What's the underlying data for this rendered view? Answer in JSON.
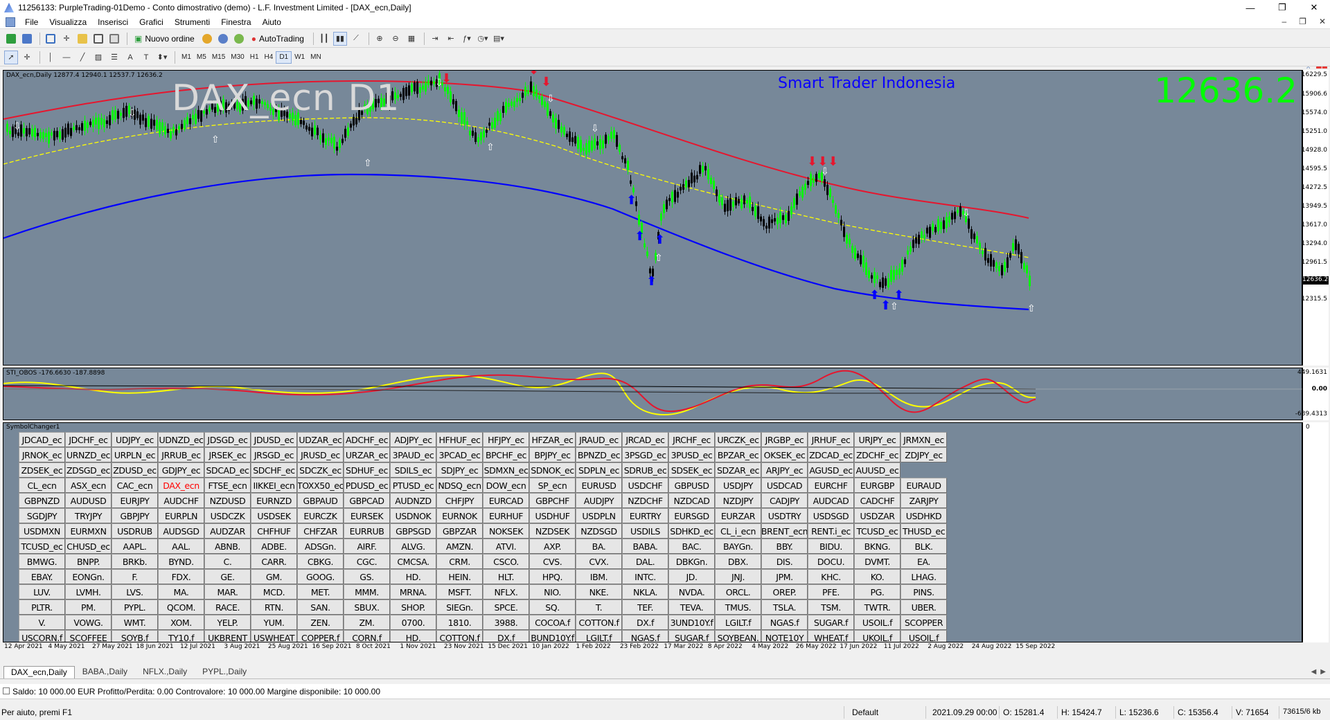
{
  "window": {
    "title": "11256133: PurpleTrading-01Demo - Conto dimostrativo (demo) - L.F. Investment Limited - [DAX_ecn,Daily]",
    "minimize": "—",
    "restore": "❐",
    "close": "✕"
  },
  "menu": [
    "File",
    "Visualizza",
    "Inserisci",
    "Grafici",
    "Strumenti",
    "Finestra",
    "Aiuto"
  ],
  "toolbar": {
    "new_order_label": "Nuovo ordine",
    "autotrading_label": "AutoTrading",
    "notification_count": "1"
  },
  "timeframes": [
    "M1",
    "M5",
    "M15",
    "M30",
    "H1",
    "H4",
    "D1",
    "W1",
    "MN"
  ],
  "active_timeframe": "D1",
  "chart": {
    "info": "DAX_ecn,Daily  12877.4 12940.1 12537.7 12636.2",
    "symbol_watermark": "DAX_ecn D1",
    "brand": "Smart Trader Indonesia",
    "current_price": "12636.2",
    "current_price_tag": "12636.2",
    "price_ticks": [
      "16229.5",
      "15906.6",
      "15574.0",
      "15251.0",
      "14928.0",
      "14595.5",
      "14272.5",
      "13949.5",
      "13617.0",
      "13294.0",
      "12961.5",
      "12315.5"
    ],
    "colors": {
      "background": "#778899",
      "bull": "#00ff00",
      "bear": "#000000",
      "upper_band": "#e6162e",
      "lower_band": "#0000ff",
      "mid_line": "#ffff00"
    }
  },
  "oscillator": {
    "label": "STI_OBOS -176.6630 -187.8898",
    "ticks": [
      "449.1631",
      "0.00",
      "-639.4313"
    ]
  },
  "symbol_changer": {
    "label": "SymbolChanger1",
    "axis_tick": "0",
    "highlighted": "DAX_ecn",
    "rows": [
      [
        "JDCAD_ec",
        "JDCHF_ec",
        "UDJPY_ec",
        "UDNZD_ec",
        "JDSGD_ec",
        "JDUSD_ec",
        "UDZAR_ec",
        "ADCHF_ec",
        "ADJPY_ec",
        "HFHUF_ec",
        "HFJPY_ec",
        "HFZAR_ec",
        "JRAUD_ec",
        "JRCAD_ec",
        "JRCHF_ec",
        "URCZK_ec",
        "JRGBP_ec",
        "JRHUF_ec",
        "URJPY_ec",
        "JRMXN_ec"
      ],
      [
        "JRNOK_ec",
        "URNZD_ec",
        "URPLN_ec",
        "JRRUB_ec",
        "JRSEK_ec",
        "JRSGD_ec",
        "JRUSD_ec",
        "URZAR_ec",
        "3PAUD_ec",
        "3PCAD_ec",
        "BPCHF_ec",
        "BPJPY_ec",
        "BPNZD_ec",
        "3PSGD_ec",
        "3PUSD_ec",
        "BPZAR_ec",
        "OKSEK_ec",
        "ZDCAD_ec",
        "ZDCHF_ec",
        "ZDJPY_ec"
      ],
      [
        "ZDSEK_ec",
        "ZDSGD_ec",
        "ZDUSD_ec",
        "GDJPY_ec",
        "SDCAD_ec",
        "SDCHF_ec",
        "SDCZK_ec",
        "SDHUF_ec",
        "SDILS_ec",
        "SDJPY_ec",
        "SDMXN_ec",
        "SDNOK_ec",
        "SDPLN_ec",
        "SDRUB_ec",
        "SDSEK_ec",
        "SDZAR_ec",
        "ARJPY_ec",
        "AGUSD_ec",
        "AUUSD_ec",
        ""
      ],
      [
        "CL_ecn",
        "ASX_ecn",
        "CAC_ecn",
        "DAX_ecn",
        "FTSE_ecn",
        "IIKKEI_ecn",
        "TOXX50_ec",
        "PDUSD_ec",
        "PTUSD_ec",
        "NDSQ_ecn",
        "DOW_ecn",
        "SP_ecn",
        "EURUSD",
        "USDCHF",
        "GBPUSD",
        "USDJPY",
        "USDCAD",
        "EURCHF",
        "EURGBP",
        "EURAUD"
      ],
      [
        "GBPNZD",
        "AUDUSD",
        "EURJPY",
        "AUDCHF",
        "NZDUSD",
        "EURNZD",
        "GBPAUD",
        "GBPCAD",
        "AUDNZD",
        "CHFJPY",
        "EURCAD",
        "GBPCHF",
        "AUDJPY",
        "NZDCHF",
        "NZDCAD",
        "NZDJPY",
        "CADJPY",
        "AUDCAD",
        "CADCHF",
        "ZARJPY"
      ],
      [
        "SGDJPY",
        "TRYJPY",
        "GBPJPY",
        "EURPLN",
        "USDCZK",
        "USDSEK",
        "EURCZK",
        "EURSEK",
        "USDNOK",
        "EURNOK",
        "EURHUF",
        "USDHUF",
        "USDPLN",
        "EURTRY",
        "EURSGD",
        "EURZAR",
        "USDTRY",
        "USDSGD",
        "USDZAR",
        "USDHKD"
      ],
      [
        "USDMXN",
        "EURMXN",
        "USDRUB",
        "AUDSGD",
        "AUDZAR",
        "CHFHUF",
        "CHFZAR",
        "EURRUB",
        "GBPSGD",
        "GBPZAR",
        "NOKSEK",
        "NZDSEK",
        "NZDSGD",
        "USDILS",
        "SDHKD_ec",
        "CL_i_ecn",
        "BRENT_ecn",
        "RENT.i_ec",
        "TCUSD_ec",
        "THUSD_ec"
      ],
      [
        "TCUSD_ec",
        "CHUSD_ec",
        "AAPL.",
        "AAL.",
        "ABNB.",
        "ADBE.",
        "ADSGn.",
        "AIRF.",
        "ALVG.",
        "AMZN.",
        "ATVI.",
        "AXP.",
        "BA.",
        "BABA.",
        "BAC.",
        "BAYGn.",
        "BBY.",
        "BIDU.",
        "BKNG.",
        "BLK."
      ],
      [
        "BMWG.",
        "BNPP.",
        "BRKb.",
        "BYND.",
        "C.",
        "CARR.",
        "CBKG.",
        "CGC.",
        "CMCSA.",
        "CRM.",
        "CSCO.",
        "CVS.",
        "CVX.",
        "DAL.",
        "DBKGn.",
        "DBX.",
        "DIS.",
        "DOCU.",
        "DVMT.",
        "EA."
      ],
      [
        "EBAY.",
        "EONGn.",
        "F.",
        "FDX.",
        "GE.",
        "GM.",
        "GOOG.",
        "GS.",
        "HD.",
        "HEIN.",
        "HLT.",
        "HPQ.",
        "IBM.",
        "INTC.",
        "JD.",
        "JNJ.",
        "JPM.",
        "KHC.",
        "KO.",
        "LHAG."
      ],
      [
        "LUV.",
        "LVMH.",
        "LVS.",
        "MA.",
        "MAR.",
        "MCD.",
        "MET.",
        "MMM.",
        "MRNA.",
        "MSFT.",
        "NFLX.",
        "NIO.",
        "NKE.",
        "NKLA.",
        "NVDA.",
        "ORCL.",
        "OREP.",
        "PFE.",
        "PG.",
        "PINS."
      ],
      [
        "PLTR.",
        "PM.",
        "PYPL.",
        "QCOM.",
        "RACE.",
        "RTN.",
        "SAN.",
        "SBUX.",
        "SHOP.",
        "SIEGn.",
        "SPCE.",
        "SQ.",
        "T.",
        "TEF.",
        "TEVA.",
        "TMUS.",
        "TSLA.",
        "TSM.",
        "TWTR.",
        "UBER."
      ],
      [
        "V.",
        "VOWG.",
        "WMT.",
        "XOM.",
        "YELP.",
        "YUM.",
        "ZEN.",
        "ZM.",
        "0700.",
        "1810.",
        "3988.",
        "COCOA.f",
        "COTTON.f",
        "DX.f",
        "3UND10Y.f",
        "LGILT.f",
        "NGAS.f",
        "SUGAR.f",
        "USOIL.f",
        "SCOPPER"
      ],
      [
        "USCORN.f",
        "SCOFFEE",
        "SOYB.f",
        "TY10.f",
        "UKBRENT",
        "USWHEAT",
        "COPPER.f",
        "CORN.f",
        "HD.",
        "COTTON.f",
        "DX.f",
        "BUND10Y.f",
        "LGILT.f",
        "NGAS.f",
        "SUGAR.f",
        "SOYBEAN.",
        "NOTE10Y",
        "WHEAT.f",
        "UKOIL.f",
        "USOIL.f"
      ]
    ]
  },
  "time_labels": [
    "12 Apr 2021",
    "4 May 2021",
    "27 May 2021",
    "18 Jun 2021",
    "12 Jul 2021",
    "3 Aug 2021",
    "25 Aug 2021",
    "16 Sep 2021",
    "8 Oct 2021",
    "1 Nov 2021",
    "23 Nov 2021",
    "15 Dec 2021",
    "10 Jan 2022",
    "1 Feb 2022",
    "23 Feb 2022",
    "17 Mar 2022",
    "8 Apr 2022",
    "4 May 2022",
    "26 May 2022",
    "17 Jun 2022",
    "11 Jul 2022",
    "2 Aug 2022",
    "24 Aug 2022",
    "15 Sep 2022"
  ],
  "tabs": [
    "DAX_ecn,Daily",
    "BABA.,Daily",
    "NFLX.,Daily",
    "PYPL.,Daily"
  ],
  "active_tab": "DAX_ecn,Daily",
  "terminal": {
    "summary": "Saldo: 10 000.00 EUR  Profitto/Perdita: 0.00  Controvalore: 10 000.00  Margine disponibile: 10 000.00"
  },
  "status": {
    "help": "Per aiuto, premi F1",
    "profile": "Default",
    "datetime": "2021.09.29 00:00",
    "open": "O: 15281.4",
    "high": "H: 15424.7",
    "low": "L: 15236.6",
    "close": "C: 15356.4",
    "volume": "V: 71654",
    "traffic": "73615/6 kb"
  }
}
